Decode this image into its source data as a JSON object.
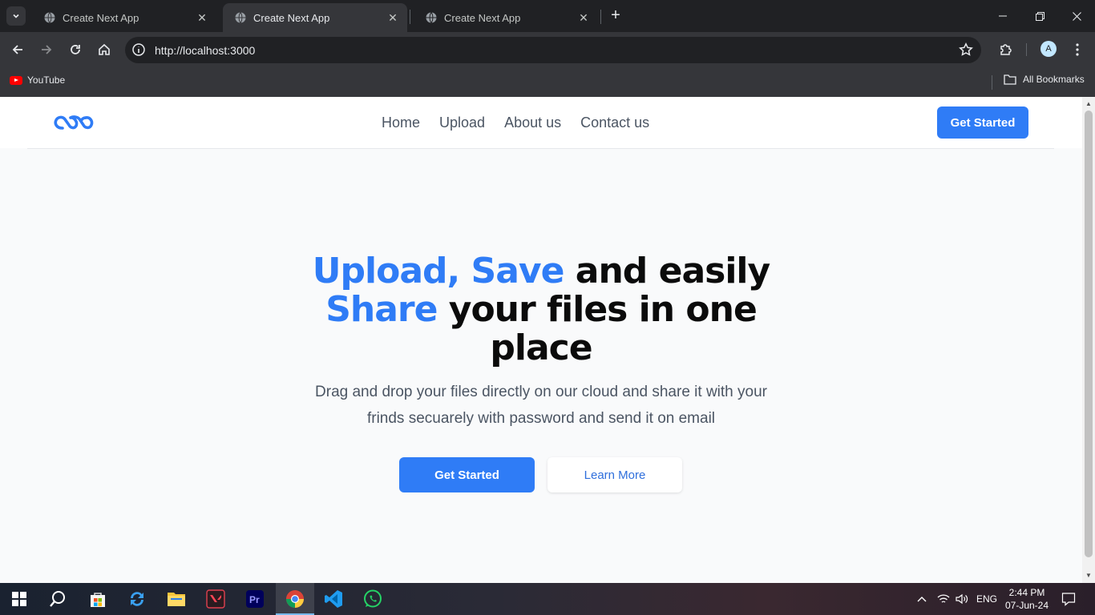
{
  "browser": {
    "tabs": [
      {
        "title": "Create Next App",
        "active": false
      },
      {
        "title": "Create Next App",
        "active": true
      },
      {
        "title": "Create Next App",
        "active": false
      }
    ],
    "url": "http://localhost:3000",
    "profile_initial": "A",
    "bookmarks": {
      "youtube": "YouTube",
      "all": "All Bookmarks"
    }
  },
  "navbar": {
    "links": [
      "Home",
      "Upload",
      "About us",
      "Contact us"
    ],
    "cta": "Get Started"
  },
  "hero": {
    "title_parts": {
      "hl1": "Upload, Save",
      "t1": " and easily ",
      "hl2": "Share",
      "t2": " your files in one place"
    },
    "subtitle": "Drag and drop your files directly on our cloud and share it with your frinds secuarely with password and send it on email",
    "primary_cta": "Get Started",
    "secondary_cta": "Learn More"
  },
  "taskbar": {
    "language": "ENG",
    "time": "2:44 PM",
    "date": "07-Jun-24"
  },
  "colors": {
    "accent": "#2f7cf6",
    "page_bg": "#f9fafb",
    "chrome_dark": "#202124"
  }
}
